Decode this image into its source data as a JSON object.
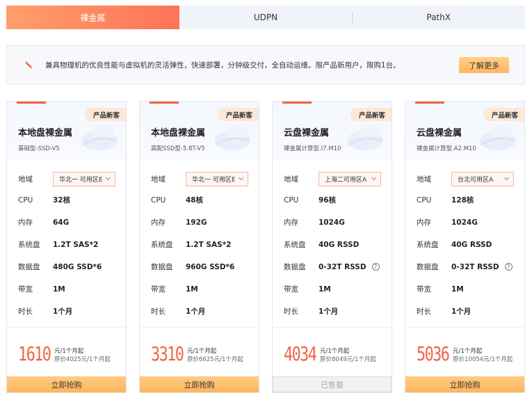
{
  "tabs": [
    {
      "label": "裸金属",
      "active": true
    },
    {
      "label": "UDPN",
      "active": false
    },
    {
      "label": "PathX",
      "active": false
    }
  ],
  "notice": {
    "icon": "rocket-icon",
    "text": "兼具物理机的优良性能与虚拟机的灵活弹性，快速部署，分钟级交付，全自动运维。限产品新用户，限购1台。",
    "button_label": "了解更多"
  },
  "labels": {
    "region": "地域",
    "cpu": "CPU",
    "memory": "内存",
    "system_disk": "系统盘",
    "data_disk": "数据盘",
    "bandwidth": "带宽",
    "duration": "时长"
  },
  "cards": [
    {
      "badge": "产品新客",
      "title": "本地盘裸金属",
      "subtitle": "基础型-SSD-V5",
      "region": "华北一 可用区E",
      "cpu": "32核",
      "memory": "64G",
      "system_disk": "1.2T SAS*2",
      "data_disk": "480G SSD*6",
      "data_disk_help": false,
      "bandwidth": "1M",
      "duration": "1个月",
      "price": "1610",
      "price_unit": "元/1个月起",
      "original_price": "原价4025元/1个月起",
      "button_label": "立即抢购",
      "sold_out": false
    },
    {
      "badge": "产品新客",
      "title": "本地盘裸金属",
      "subtitle": "高配SSD型-5.8T-V5",
      "region": "华北一 可用区E",
      "cpu": "48核",
      "memory": "192G",
      "system_disk": "1.2T SAS*2",
      "data_disk": "960G SSD*6",
      "data_disk_help": false,
      "bandwidth": "1M",
      "duration": "1个月",
      "price": "3310",
      "price_unit": "元/1个月起",
      "original_price": "原价6625元/1个月起",
      "button_label": "立即抢购",
      "sold_out": false
    },
    {
      "badge": "产品新客",
      "title": "云盘裸金属",
      "subtitle": "裸金属计算型.I7.M10",
      "region": "上海二可用区A",
      "cpu": "96核",
      "memory": "1024G",
      "system_disk": "40G RSSD",
      "data_disk": "0-32T RSSD",
      "data_disk_help": true,
      "bandwidth": "1M",
      "duration": "1个月",
      "price": "4034",
      "price_unit": "元/1个月起",
      "original_price": "原价8049元/1个月起",
      "button_label": "已售罄",
      "sold_out": true
    },
    {
      "badge": "产品新客",
      "title": "云盘裸金属",
      "subtitle": "裸金属计算型.A2.M10",
      "region": "台北可用区A",
      "cpu": "128核",
      "memory": "1024G",
      "system_disk": "40G RSSD",
      "data_disk": "0-32T RSSD",
      "data_disk_help": true,
      "bandwidth": "1M",
      "duration": "1个月",
      "price": "5036",
      "price_unit": "元/1个月起",
      "original_price": "原价10054元/1个月起",
      "button_label": "立即抢购",
      "sold_out": false
    }
  ]
}
